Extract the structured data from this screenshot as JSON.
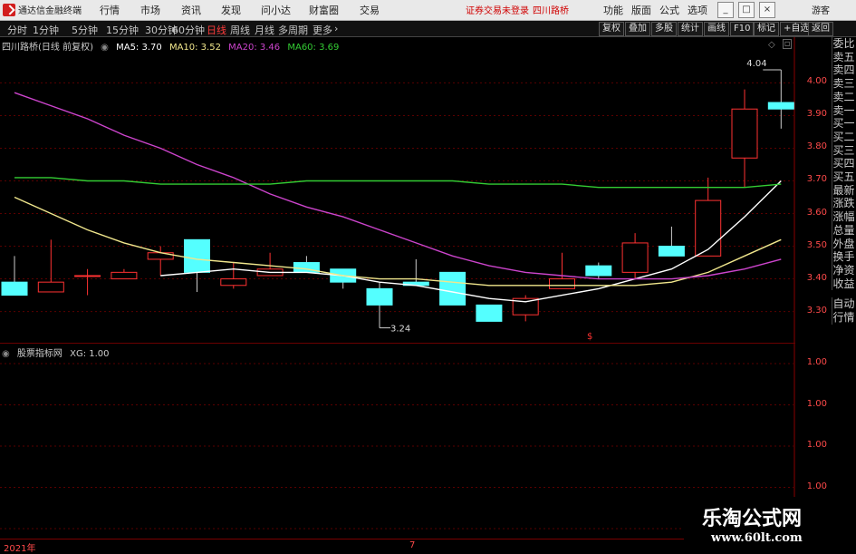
{
  "app": {
    "title": "通达信金融终端",
    "login_status": "证券交易未登录",
    "stock_name_header": "四川路桥"
  },
  "menu": {
    "items": [
      "行情",
      "市场",
      "资讯",
      "发现",
      "问小达",
      "财富圈",
      "交易"
    ],
    "right_items": [
      "功能",
      "版面",
      "公式",
      "选项"
    ],
    "guest": "游客"
  },
  "timeframes": [
    "分时",
    "1分钟",
    "5分钟",
    "15分钟",
    "30分钟",
    "60分钟",
    "日线",
    "周线",
    "月线",
    "多周期",
    "更多"
  ],
  "active_timeframe": "日线",
  "tool_buttons": [
    "复权",
    "叠加",
    "多股",
    "统计",
    "画线",
    "F10",
    "标记",
    "+自选",
    "返回"
  ],
  "main_chart": {
    "title": "四川路桥(日线 前复权)",
    "indicators": [
      {
        "label": "MA5: 3.70",
        "color": "#ffffff"
      },
      {
        "label": "MA10: 3.52",
        "color": "#f0e68c"
      },
      {
        "label": "MA20: 3.46",
        "color": "#cc44cc"
      },
      {
        "label": "MA60: 3.69",
        "color": "#33cc33"
      }
    ],
    "annotations": {
      "high_label": "4.04",
      "low_label": "3.24"
    }
  },
  "sub_chart": {
    "title": "股票指标网",
    "value_label": "XG: 1.00"
  },
  "chart_data": [
    {
      "type": "candlestick",
      "ylim": [
        3.21,
        4.09
      ],
      "y_ticks": [
        "4.00",
        "3.90",
        "3.80",
        "3.70",
        "3.60",
        "3.50",
        "3.40",
        "3.30"
      ],
      "candles": [
        {
          "o": 3.39,
          "h": 3.47,
          "l": 3.35,
          "c": 3.35
        },
        {
          "o": 3.36,
          "h": 3.52,
          "l": 3.36,
          "c": 3.39
        },
        {
          "o": 3.41,
          "h": 3.43,
          "l": 3.35,
          "c": 3.41
        },
        {
          "o": 3.4,
          "h": 3.43,
          "l": 3.4,
          "c": 3.42
        },
        {
          "o": 3.46,
          "h": 3.5,
          "l": 3.41,
          "c": 3.48
        },
        {
          "o": 3.52,
          "h": 3.52,
          "l": 3.36,
          "c": 3.42
        },
        {
          "o": 3.38,
          "h": 3.45,
          "l": 3.37,
          "c": 3.4
        },
        {
          "o": 3.41,
          "h": 3.48,
          "l": 3.41,
          "c": 3.43
        },
        {
          "o": 3.45,
          "h": 3.47,
          "l": 3.42,
          "c": 3.42
        },
        {
          "o": 3.43,
          "h": 3.43,
          "l": 3.37,
          "c": 3.39
        },
        {
          "o": 3.37,
          "h": 3.39,
          "l": 3.25,
          "c": 3.32
        },
        {
          "o": 3.39,
          "h": 3.46,
          "l": 3.38,
          "c": 3.38
        },
        {
          "o": 3.42,
          "h": 3.42,
          "l": 3.32,
          "c": 3.32
        },
        {
          "o": 3.32,
          "h": 3.32,
          "l": 3.27,
          "c": 3.27
        },
        {
          "o": 3.29,
          "h": 3.35,
          "l": 3.27,
          "c": 3.34
        },
        {
          "o": 3.37,
          "h": 3.48,
          "l": 3.37,
          "c": 3.4
        },
        {
          "o": 3.44,
          "h": 3.45,
          "l": 3.4,
          "c": 3.41
        },
        {
          "o": 3.42,
          "h": 3.54,
          "l": 3.4,
          "c": 3.51
        },
        {
          "o": 3.5,
          "h": 3.56,
          "l": 3.47,
          "c": 3.47
        },
        {
          "o": 3.47,
          "h": 3.71,
          "l": 3.47,
          "c": 3.64
        },
        {
          "o": 3.77,
          "h": 3.98,
          "l": 3.68,
          "c": 3.92
        },
        {
          "o": 3.94,
          "h": 4.04,
          "l": 3.86,
          "c": 3.92
        }
      ],
      "ma_lines": [
        {
          "name": "MA5",
          "color": "#ffffff",
          "values": [
            null,
            null,
            null,
            null,
            3.41,
            3.42,
            3.43,
            3.42,
            3.42,
            3.41,
            3.39,
            3.38,
            3.36,
            3.34,
            3.33,
            3.35,
            3.37,
            3.4,
            3.43,
            3.49,
            3.59,
            3.7
          ]
        },
        {
          "name": "MA10",
          "color": "#f0e68c",
          "values": [
            3.65,
            3.6,
            3.55,
            3.51,
            3.48,
            3.46,
            3.45,
            3.44,
            3.43,
            3.41,
            3.4,
            3.4,
            3.39,
            3.38,
            3.38,
            3.38,
            3.38,
            3.38,
            3.39,
            3.42,
            3.47,
            3.52
          ]
        },
        {
          "name": "MA20",
          "color": "#cc44cc",
          "values": [
            3.97,
            3.93,
            3.89,
            3.84,
            3.8,
            3.75,
            3.71,
            3.66,
            3.62,
            3.59,
            3.55,
            3.51,
            3.47,
            3.44,
            3.42,
            3.41,
            3.4,
            3.4,
            3.4,
            3.41,
            3.43,
            3.46
          ]
        },
        {
          "name": "MA60",
          "color": "#33cc33",
          "values": [
            3.71,
            3.71,
            3.7,
            3.7,
            3.69,
            3.69,
            3.69,
            3.69,
            3.7,
            3.7,
            3.7,
            3.7,
            3.7,
            3.69,
            3.69,
            3.69,
            3.68,
            3.68,
            3.68,
            3.68,
            3.68,
            3.69
          ]
        }
      ]
    },
    {
      "type": "line",
      "ylim": [
        0.94,
        1.06
      ],
      "y_ticks": [
        "1.00",
        "1.00",
        "1.00",
        "1.00",
        "1.00"
      ],
      "series": [
        {
          "name": "XG",
          "values": []
        }
      ]
    }
  ],
  "right_panel": [
    "委比",
    "卖五",
    "卖四",
    "卖三",
    "卖二",
    "卖一",
    "买一",
    "买二",
    "买三",
    "买四",
    "买五",
    "最新",
    "涨跌",
    "涨幅",
    "总量",
    "外盘",
    "换手",
    "净资",
    "收益",
    "自动",
    "行情"
  ],
  "date_axis": {
    "labels": [
      "2021年",
      "7"
    ]
  },
  "watermark": {
    "line1": "乐淘公式网",
    "line2": "www.60lt.com"
  }
}
